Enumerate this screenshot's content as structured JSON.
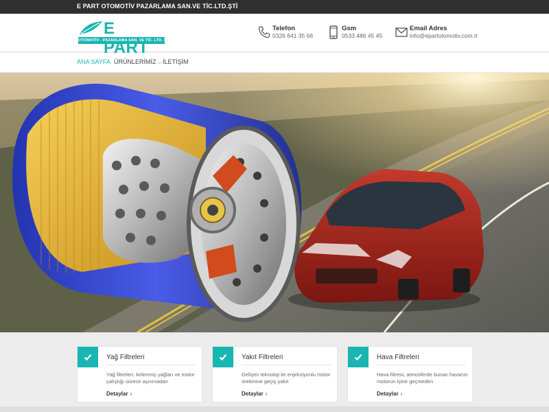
{
  "topbar": {
    "company": "E PART OTOMOTİV PAZARLAMA SAN.VE TİC.LTD.ŞTİ"
  },
  "logo": {
    "title": "E PART",
    "tagline": "OTOMOTİV - PAZARLAMA SAN. VE TİC. LTD. ŞTİ."
  },
  "contacts": [
    {
      "title": "Telefon",
      "value": "0326 641 35 66",
      "icon": "phone-icon"
    },
    {
      "title": "Gsm",
      "value": "0533 486 45 45",
      "icon": "mobile-icon"
    },
    {
      "title": "Email Adres",
      "value": "info@epartotomotiv.com.tr",
      "icon": "mail-icon"
    }
  ],
  "nav": {
    "items": [
      {
        "label": "ANA SAYFA",
        "active": true
      },
      {
        "label": "ÜRÜNLERİMİZ",
        "dropdown": true
      },
      {
        "label": "İLETİŞİM"
      }
    ]
  },
  "hero": {
    "description": "oil filter cutaway over red car on highway"
  },
  "cards": [
    {
      "title": "Yağ Filtreleri",
      "text": "Yağ filtreleri, kirlenmiş yağları ve motor çalıştığı sürece aşınmadan",
      "link": "Detaylar"
    },
    {
      "title": "Yakıt Filtreleri",
      "text": "Gelişen teknoloji ile enjeksiyonlu motor üretimine geçiş yakıt",
      "link": "Detaylar"
    },
    {
      "title": "Hava Filtreleri",
      "text": "Hava filtresi, atmosferde bunan havanın motorun içine geçmeden",
      "link": "Detaylar"
    }
  ],
  "colors": {
    "accent": "#19b5b0",
    "topbar": "#2f2f2f"
  }
}
